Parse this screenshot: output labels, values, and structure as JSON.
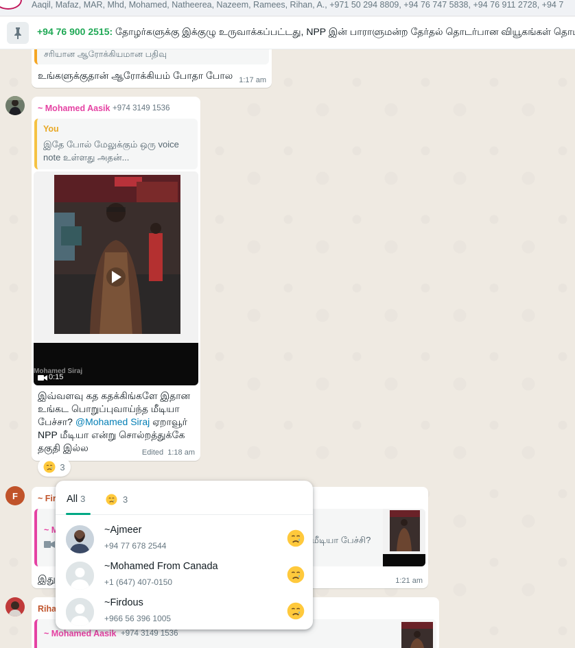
{
  "header": {
    "members": "Aaqil, Mafaz, MAR, Mhd, Mohamed, Natheerea, Nazeem, Ramees, Rihan, A., +971 50 294 8809, +94 76 747 5838, +94 76 911 2728, +94 7"
  },
  "pinned": {
    "phone": "+94 76 900 2515:",
    "text": " தோழர்களுக்கு இக்குழு உருவாக்கப்பட்டது, NPP இன் பாராளுமன்ற தேர்தல் தொடர்பான வியூகங்கள் தொடர்பா"
  },
  "messages": {
    "m1": {
      "quote_tail": "சரியான ஆரோக்கியமான பதிவு",
      "text": "உங்களுக்குதான் ஆரோக்கியம் போதா போல",
      "time": "1:17 am"
    },
    "m2": {
      "sender": "~ Mohamed Aasik",
      "phone": "+974 3149 1536",
      "quote_author": "You",
      "quote_text": "இதே போல் மேலுக்கும் ஒரு voice note உள்ளது அதன்...",
      "video_duration": "0:15",
      "video_watermark": "Mohamed Siraj",
      "body_pre": "இவ்வளவு கத கதக்கிங்களே இதான உங்கட பொறுப்புவாய்ந்த மீடியா பேச்சா? ",
      "mention": "@Mohamed Siraj",
      "body_post": " ஏறாவூர் NPP மீடியா என்று சொல்றத்துக்கே தகுதி இல்ல",
      "edited": "Edited",
      "time": "1:18 am",
      "reaction_count": "3"
    },
    "m3": {
      "avatar_letter": "F",
      "sender": "~ Fir",
      "quote_sender": "~ M",
      "quote_text": "ந்த மீடியா பேச்சி?",
      "text": "இது",
      "time": "1:21 am"
    },
    "m4": {
      "sender": "Riha",
      "quote_sender": "~ Mohamed Aasik",
      "quote_phone": "+974 3149 1536"
    }
  },
  "reactions_popup": {
    "tab_all": "All",
    "tab_all_count": "3",
    "tab_emoji_count": "3",
    "reactors": [
      {
        "name": "~Ajmeer",
        "phone": "+94 77 678 2544"
      },
      {
        "name": "~Mohamed From Canada",
        "phone": "+1 (647) 407-0150"
      },
      {
        "name": "~Firdous",
        "phone": "+966 56 396 1005"
      }
    ]
  },
  "colors": {
    "pin_phone": "#1fa855",
    "sender_aasik": "#e542a3",
    "sender_fir": "#c0532a",
    "accent": "#00a884"
  }
}
